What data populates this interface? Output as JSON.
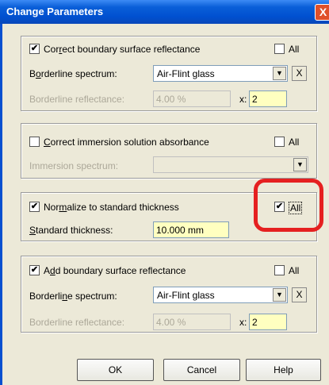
{
  "window": {
    "title": "Change Parameters",
    "close": "X"
  },
  "group1": {
    "checkbox_label_pre": "Cor",
    "checkbox_label_u": "r",
    "checkbox_label_post": "ect boundary surface reflectance",
    "all_label": "All",
    "spectrum_label_pre": "B",
    "spectrum_label_u": "o",
    "spectrum_label_post": "rderline spectrum:",
    "spectrum_value": "Air-Flint glass",
    "x_button": "X",
    "reflectance_label": "Borderline reflectance:",
    "reflectance_value": "4.00 %",
    "factor_label": "x:",
    "factor_value": "2",
    "checked": true
  },
  "group2": {
    "checkbox_label_pre": "",
    "checkbox_label_u": "C",
    "checkbox_label_post": "orrect immersion solution absorbance",
    "all_label": "All",
    "spectrum_label": "Immersion spectrum:",
    "spectrum_value": "",
    "checked": false
  },
  "group3": {
    "checkbox_label_pre": "Nor",
    "checkbox_label_u": "m",
    "checkbox_label_post": "alize to standard thickness",
    "all_label": "All",
    "thickness_label_pre": "",
    "thickness_label_u": "S",
    "thickness_label_post": "tandard thickness:",
    "thickness_value": "10.000 mm",
    "checked": true,
    "all_checked": true
  },
  "group4": {
    "checkbox_label_pre": "A",
    "checkbox_label_u": "d",
    "checkbox_label_post": "d boundary surface reflectance",
    "all_label": "All",
    "spectrum_label_pre": "Borderli",
    "spectrum_label_u": "n",
    "spectrum_label_post": "e spectrum:",
    "spectrum_value": "Air-Flint glass",
    "x_button": "X",
    "reflectance_label": "Borderline reflectance:",
    "reflectance_value": "4.00 %",
    "factor_label": "x:",
    "factor_value": "2",
    "checked": true
  },
  "buttons": {
    "ok": "OK",
    "cancel": "Cancel",
    "help": "Help"
  },
  "check_mark": "✔",
  "arrow_glyph": "▼",
  "colors": {
    "titlebar": "#0a5fd8",
    "highlight": "#e52020",
    "field_yellow": "#ffffc0"
  }
}
